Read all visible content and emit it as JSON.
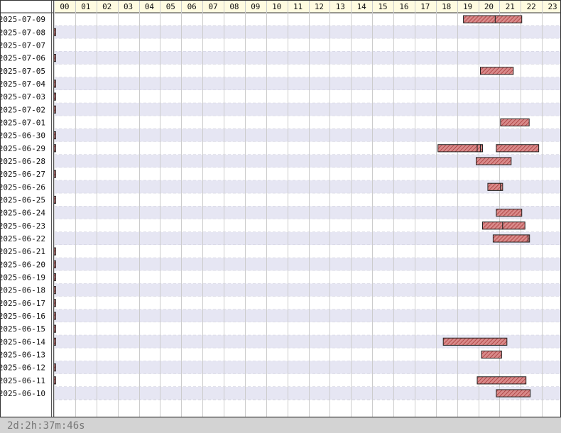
{
  "chart_data": {
    "type": "timeline",
    "hours": [
      "00",
      "01",
      "02",
      "03",
      "04",
      "05",
      "06",
      "07",
      "08",
      "09",
      "10",
      "11",
      "12",
      "13",
      "14",
      "15",
      "16",
      "17",
      "18",
      "19",
      "20",
      "21",
      "22",
      "23"
    ],
    "rows": [
      {
        "date": "2025-07-09",
        "sessions": [
          [
            19.3,
            20.8
          ],
          [
            20.8,
            22.05
          ]
        ]
      },
      {
        "date": "2025-07-08",
        "sessions": [
          [
            0,
            0.08
          ]
        ]
      },
      {
        "date": "2025-07-07",
        "sessions": []
      },
      {
        "date": "2025-07-06",
        "sessions": [
          [
            0,
            0.08
          ]
        ]
      },
      {
        "date": "2025-07-05",
        "sessions": [
          [
            20.1,
            21.65
          ]
        ]
      },
      {
        "date": "2025-07-04",
        "sessions": [
          [
            0,
            0.08
          ]
        ]
      },
      {
        "date": "2025-07-03",
        "sessions": [
          [
            0,
            0.08
          ]
        ]
      },
      {
        "date": "2025-07-02",
        "sessions": [
          [
            0,
            0.08
          ]
        ]
      },
      {
        "date": "2025-07-01",
        "sessions": [
          [
            21.05,
            22.4
          ]
        ]
      },
      {
        "date": "2025-06-30",
        "sessions": [
          [
            0,
            0.08
          ]
        ]
      },
      {
        "date": "2025-06-29",
        "sessions": [
          [
            0,
            0.08
          ],
          [
            18.1,
            19.95
          ],
          [
            19.95,
            20.1
          ],
          [
            20.1,
            20.2
          ],
          [
            20.85,
            22.85
          ]
        ]
      },
      {
        "date": "2025-06-28",
        "sessions": [
          [
            19.9,
            21.55
          ]
        ]
      },
      {
        "date": "2025-06-27",
        "sessions": [
          [
            0,
            0.08
          ]
        ]
      },
      {
        "date": "2025-06-26",
        "sessions": [
          [
            20.45,
            21.05
          ],
          [
            21.05,
            21.15
          ]
        ]
      },
      {
        "date": "2025-06-25",
        "sessions": [
          [
            0,
            0.08
          ]
        ]
      },
      {
        "date": "2025-06-24",
        "sessions": [
          [
            20.85,
            22.05
          ]
        ]
      },
      {
        "date": "2025-06-23",
        "sessions": [
          [
            20.2,
            21.15
          ],
          [
            21.15,
            22.2
          ]
        ]
      },
      {
        "date": "2025-06-22",
        "sessions": [
          [
            20.7,
            22.35
          ],
          [
            22.35,
            22.4
          ]
        ]
      },
      {
        "date": "2025-06-21",
        "sessions": [
          [
            0,
            0.08
          ]
        ]
      },
      {
        "date": "2025-06-20",
        "sessions": [
          [
            0,
            0.08
          ]
        ]
      },
      {
        "date": "2025-06-19",
        "sessions": [
          [
            0,
            0.08
          ]
        ]
      },
      {
        "date": "2025-06-18",
        "sessions": [
          [
            0,
            0.08
          ]
        ]
      },
      {
        "date": "2025-06-17",
        "sessions": [
          [
            0,
            0.08
          ]
        ]
      },
      {
        "date": "2025-06-16",
        "sessions": [
          [
            0,
            0.08
          ]
        ]
      },
      {
        "date": "2025-06-15",
        "sessions": [
          [
            0,
            0.08
          ]
        ]
      },
      {
        "date": "2025-06-14",
        "sessions": [
          [
            0,
            0.08
          ],
          [
            18.35,
            21.35
          ]
        ]
      },
      {
        "date": "2025-06-13",
        "sessions": [
          [
            20.15,
            21.1
          ]
        ]
      },
      {
        "date": "2025-06-12",
        "sessions": [
          [
            0,
            0.08
          ]
        ]
      },
      {
        "date": "2025-06-11",
        "sessions": [
          [
            0,
            0.08
          ],
          [
            19.95,
            22.25
          ]
        ]
      },
      {
        "date": "2025-06-10",
        "sessions": [
          [
            20.85,
            22.45
          ]
        ]
      }
    ],
    "colors": {
      "bar_fill": "#d98a8a",
      "bar_hatch": "#a83a3a",
      "bar_stroke": "#222222",
      "row_alt": "#e6e6f3",
      "row_base": "#ffffff",
      "header_bg": "#fffbe0",
      "grid": "#cccccc"
    }
  },
  "footer": {
    "elapsed": "2d:2h:37m:46s"
  }
}
